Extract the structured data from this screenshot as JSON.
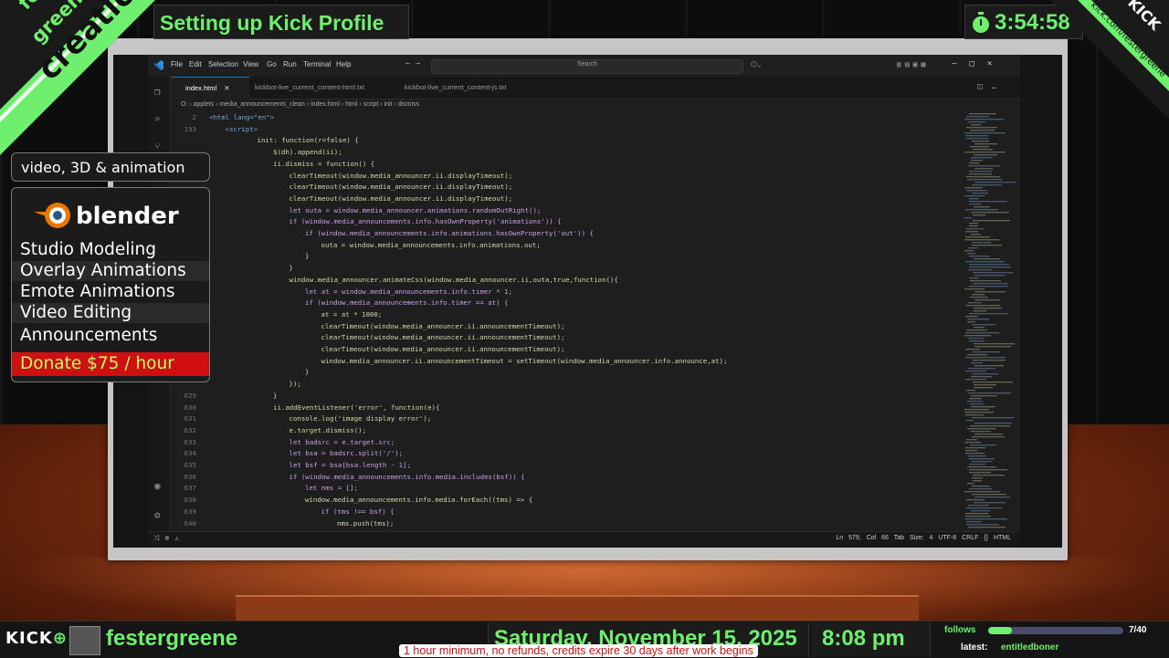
{
  "overlay": {
    "brand_top": "fester",
    "brand_mid": "greene",
    "brand_main": "creations",
    "stream_title": "Setting up Kick Profile",
    "timer": "3:54:58",
    "kick_corner_logo": "KICK",
    "kick_corner_url": "kick.com/festergreene",
    "tagline": "video, 3D & animation",
    "blender_label": "blender",
    "services": [
      "Studio Modeling",
      "Overlay Animations",
      "Emote Animations",
      "Video Editing",
      "Announcements"
    ],
    "donate": "Donate $75 / hour",
    "bottom": {
      "kick_logo": "KICK",
      "channel": "festergreene",
      "date": "Saturday, November 15, 2025",
      "time": "8:08 pm",
      "disclaimer": "1 hour minimum, no refunds, credits expire 30 days after work begins",
      "follows_label": "follows",
      "follows_count": "7/40",
      "follows_progress": 0.175,
      "latest_label": "latest:",
      "latest_name": "entitledboner"
    },
    "colors": {
      "accent_green": "#6ef06e",
      "donate_red": "#d01010"
    }
  },
  "vscode": {
    "menu": [
      "File",
      "Edit",
      "Selection",
      "View",
      "Go",
      "Run",
      "Terminal",
      "Help"
    ],
    "search_placeholder": "Search",
    "tabs": [
      {
        "label": "index.html",
        "active": true
      },
      {
        "label": "kickbot-live_current_content-html.txt",
        "active": false
      },
      {
        "label": "kickbot-live_current_content-js.txt",
        "active": false
      }
    ],
    "breadcrumb": "O: › applets › media_announcements_clean › index.html › html › script › init › dismiss",
    "status": "Ln 579, Col 66   Tab Size: 4   UTF-8   CRLF   {} HTML",
    "code_lines": [
      {
        "n": "2",
        "indent": 0,
        "t": "<html lang=\"en\">"
      },
      {
        "n": "193",
        "indent": 1,
        "t": "<script>"
      },
      {
        "n": "",
        "indent": 3,
        "t": "init: function(r=false) {"
      },
      {
        "n": "",
        "indent": 4,
        "t": "$(dh).append(ii);"
      },
      {
        "n": "",
        "indent": 4,
        "t": "ii.dismiss = function() {"
      },
      {
        "n": "",
        "indent": 5,
        "t": "clearTimeout(window.media_announcer.ii.displayTimeout);"
      },
      {
        "n": "",
        "indent": 5,
        "t": "clearTimeout(window.media_announcer.ii.displayTimeout);"
      },
      {
        "n": "",
        "indent": 5,
        "t": "clearTimeout(window.media_announcer.ii.displayTimeout);"
      },
      {
        "n": "",
        "indent": 5,
        "t": "let outa = window.media_announcer.animations.randomOutRight();"
      },
      {
        "n": "",
        "indent": 5,
        "t": "if (window.media_announcements.info.hasOwnProperty('animations')) {"
      },
      {
        "n": "",
        "indent": 6,
        "t": "if (window.media_announcements.info.animations.hasOwnProperty('out')) {"
      },
      {
        "n": "",
        "indent": 7,
        "t": "outa = window.media_announcements.info.animations.out;"
      },
      {
        "n": "",
        "indent": 6,
        "t": "}"
      },
      {
        "n": "",
        "indent": 5,
        "t": "}"
      },
      {
        "n": "",
        "indent": 5,
        "t": "window.media_announcer.animateCss(window.media_announcer.ii,outa,true,function(){"
      },
      {
        "n": "",
        "indent": 6,
        "t": "let at = window.media_announcements.info.timer * 1;"
      },
      {
        "n": "",
        "indent": 6,
        "t": "if (window.media_announcements.info.timer == at) {"
      },
      {
        "n": "",
        "indent": 7,
        "t": "at = at * 1000;"
      },
      {
        "n": "",
        "indent": 7,
        "t": "clearTimeout(window.media_announcer.ii.announcementTimeout);"
      },
      {
        "n": "",
        "indent": 7,
        "t": "clearTimeout(window.media_announcer.ii.announcementTimeout);"
      },
      {
        "n": "",
        "indent": 7,
        "t": "clearTimeout(window.media_announcer.ii.announcementTimeout);"
      },
      {
        "n": "",
        "indent": 7,
        "t": "window.media_announcer.ii.announcementTimeout = setTimeout(window.media_announcer.info.announce,at);"
      },
      {
        "n": "",
        "indent": 6,
        "t": "}"
      },
      {
        "n": "",
        "indent": 5,
        "t": "});"
      },
      {
        "n": "629",
        "indent": 4,
        "t": "}"
      },
      {
        "n": "630",
        "indent": 4,
        "t": "ii.addEventListener('error', function(e){"
      },
      {
        "n": "631",
        "indent": 5,
        "t": "console.log('image display error');"
      },
      {
        "n": "632",
        "indent": 5,
        "t": "e.target.dismiss();"
      },
      {
        "n": "633",
        "indent": 5,
        "t": "let badsrc = e.target.src;"
      },
      {
        "n": "634",
        "indent": 5,
        "t": "let bsa = badsrc.split('/');"
      },
      {
        "n": "635",
        "indent": 5,
        "t": "let bsf = bsa[bsa.length - 1];"
      },
      {
        "n": "636",
        "indent": 5,
        "t": "if (window.media_announcements.info.media.includes(bsf)) {"
      },
      {
        "n": "637",
        "indent": 6,
        "t": "let nms = [];"
      },
      {
        "n": "638",
        "indent": 6,
        "t": "window.media_announcements.info.media.forEach((tms) => {"
      },
      {
        "n": "639",
        "indent": 7,
        "t": "if (tms !== bsf) {"
      },
      {
        "n": "640",
        "indent": 8,
        "t": "nms.push(tms);"
      }
    ]
  }
}
